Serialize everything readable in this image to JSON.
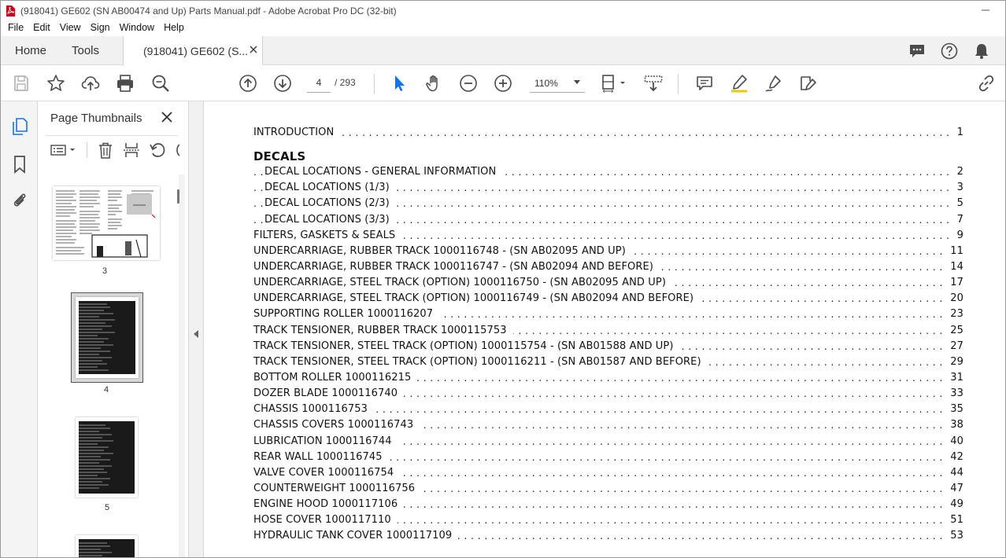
{
  "window": {
    "title": "(918041) GE602 (SN AB00474 and Up) Parts Manual.pdf - Adobe Acrobat Pro DC (32-bit)"
  },
  "menu": [
    "File",
    "Edit",
    "View",
    "Sign",
    "Window",
    "Help"
  ],
  "tabs": {
    "home": "Home",
    "tools": "Tools",
    "document": "(918041) GE602 (S..."
  },
  "toolbar": {
    "page_current": "4",
    "page_total": "/ 293",
    "zoom": "110%"
  },
  "thumbnails": {
    "panel_title": "Page Thumbnails",
    "pages": [
      "3",
      "4",
      "5"
    ],
    "selected": "4"
  },
  "toc": {
    "introduction": {
      "title": "INTRODUCTION",
      "page": "1"
    },
    "section_decals": "DECALS",
    "entries": [
      {
        "title": "DECAL LOCATIONS - GENERAL INFORMATION",
        "page": "2",
        "indent": true
      },
      {
        "title": "DECAL LOCATIONS (1/3)",
        "page": "3",
        "indent": true
      },
      {
        "title": "DECAL LOCATIONS (2/3)",
        "page": "5",
        "indent": true
      },
      {
        "title": "DECAL LOCATIONS (3/3)",
        "page": "7",
        "indent": true
      },
      {
        "title": "FILTERS, GASKETS & SEALS",
        "page": "9"
      },
      {
        "title": "UNDERCARRIAGE, RUBBER TRACK 1000116748 - (SN AB02095 AND UP)",
        "page": "11"
      },
      {
        "title": "UNDERCARRIAGE, RUBBER TRACK 1000116747 - (SN AB02094 AND BEFORE)",
        "page": "14"
      },
      {
        "title": "UNDERCARRIAGE, STEEL TRACK (OPTION) 1000116750 - (SN AB02095 AND UP)",
        "page": "17"
      },
      {
        "title": "UNDERCARRIAGE, STEEL TRACK (OPTION) 1000116749 - (SN AB02094 AND BEFORE)",
        "page": "20"
      },
      {
        "title": "SUPPORTING ROLLER 1000116207",
        "page": "23"
      },
      {
        "title": "TRACK TENSIONER, RUBBER TRACK 1000115753",
        "page": "25"
      },
      {
        "title": "TRACK TENSIONER, STEEL TRACK (OPTION) 1000115754 - (SN AB01588 AND UP)",
        "page": "27"
      },
      {
        "title": "TRACK TENSIONER, STEEL TRACK (OPTION) 1000116211 - (SN AB01587 AND BEFORE)",
        "page": "29"
      },
      {
        "title": "BOTTOM ROLLER 1000116215",
        "page": "31"
      },
      {
        "title": "DOZER BLADE 1000116740",
        "page": "33"
      },
      {
        "title": "CHASSIS 1000116753",
        "page": "35"
      },
      {
        "title": "CHASSIS COVERS 1000116743",
        "page": "38"
      },
      {
        "title": "LUBRICATION 1000116744",
        "page": "40"
      },
      {
        "title": "REAR WALL 1000116745",
        "page": "42"
      },
      {
        "title": "VALVE COVER 1000116754",
        "page": "44"
      },
      {
        "title": "COUNTERWEIGHT 1000116756",
        "page": "47"
      },
      {
        "title": "ENGINE HOOD 1000117106",
        "page": "49"
      },
      {
        "title": "HOSE COVER 1000117110",
        "page": "51"
      },
      {
        "title": "HYDRAULIC TANK COVER 1000117109",
        "page": "53"
      }
    ]
  },
  "colors": {
    "accent_blue": "#1473e6",
    "icon_gray": "#4b4b4b",
    "acrobat_red": "#d0021b"
  }
}
